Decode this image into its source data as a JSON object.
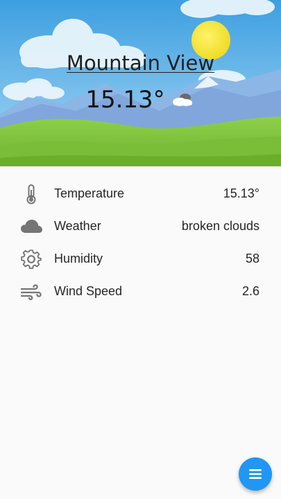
{
  "location": {
    "city": "Mountain View"
  },
  "current": {
    "temperature": "15.13°",
    "condition_icon": "broken-clouds-icon"
  },
  "details": [
    {
      "icon": "thermometer-icon",
      "label": "Temperature",
      "value": "15.13°"
    },
    {
      "icon": "cloud-icon",
      "label": "Weather",
      "value": "broken clouds"
    },
    {
      "icon": "gear-icon",
      "label": "Humidity",
      "value": "58"
    },
    {
      "icon": "wind-icon",
      "label": "Wind Speed",
      "value": "2.6"
    }
  ],
  "fab": {
    "icon": "menu-icon"
  },
  "colors": {
    "accent": "#2196f3",
    "sky": "#4aa6e3",
    "grass": "#7cbf3a",
    "sun": "#f2e233",
    "icon_gray": "#757575"
  }
}
